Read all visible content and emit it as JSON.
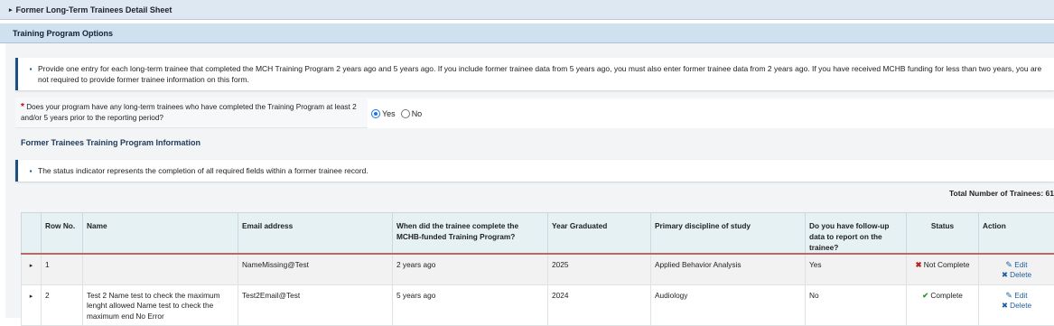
{
  "top_section": {
    "title": "Former Long-Term Trainees Detail Sheet"
  },
  "options_header": {
    "title": "Training Program Options"
  },
  "info_note": "Provide one entry for each long-term trainee that completed the MCH Training Program 2 years ago and 5 years ago. If you include former trainee data from 5 years ago, you must also enter former trainee data from 2 years ago. If you have received MCHB funding for less than two years, you are not required to provide former trainee information on this form.",
  "question": {
    "required_mark": "*",
    "text": "Does your program have any long-term trainees who have completed the Training Program at least 2 and/or 5 years prior to the reporting period?",
    "yes_label": "Yes",
    "no_label": "No",
    "selected": "Yes"
  },
  "section_title": "Former Trainees Training Program Information",
  "status_note": "The status indicator represents the completion of all required fields within a former trainee record.",
  "total_label": "Total Number of Trainees: 61",
  "table": {
    "columns": [
      "Row No.",
      "Name",
      "Email address",
      "When did the trainee complete the MCHB-funded Training Program?",
      "Year Graduated",
      "Primary discipline of study",
      "Do you have follow-up data to report on the trainee?",
      "Status",
      "Action"
    ],
    "rows": [
      {
        "row_no": "1",
        "name": "",
        "email": "NameMissing@Test",
        "when": "2 years ago",
        "year": "2025",
        "discipline": "Applied Behavior Analysis",
        "followup": "Yes",
        "status": "Not Complete",
        "edit": "Edit",
        "delete": "Delete"
      },
      {
        "row_no": "2",
        "name": "Test 2 Name test to check the maximum lenght allowed Name test to check the maximum end No Error",
        "email": "Test2Email@Test",
        "when": "5 years ago",
        "year": "2024",
        "discipline": "Audiology",
        "followup": "No",
        "status": "Complete",
        "edit": "Edit",
        "delete": "Delete"
      }
    ]
  },
  "icons": {
    "caret": "caret-right-icon",
    "note": "note-icon",
    "status_x": "x-icon",
    "status_check": "check-icon",
    "edit": "edit-icon",
    "delete": "delete-icon"
  },
  "colors": {
    "header_bg": "#cfe0ee",
    "note_border": "#1e4f7e",
    "required": "#cc0000",
    "not_complete": "#bb2222",
    "complete": "#2a9a2a",
    "action_link": "#1f5e9c"
  }
}
